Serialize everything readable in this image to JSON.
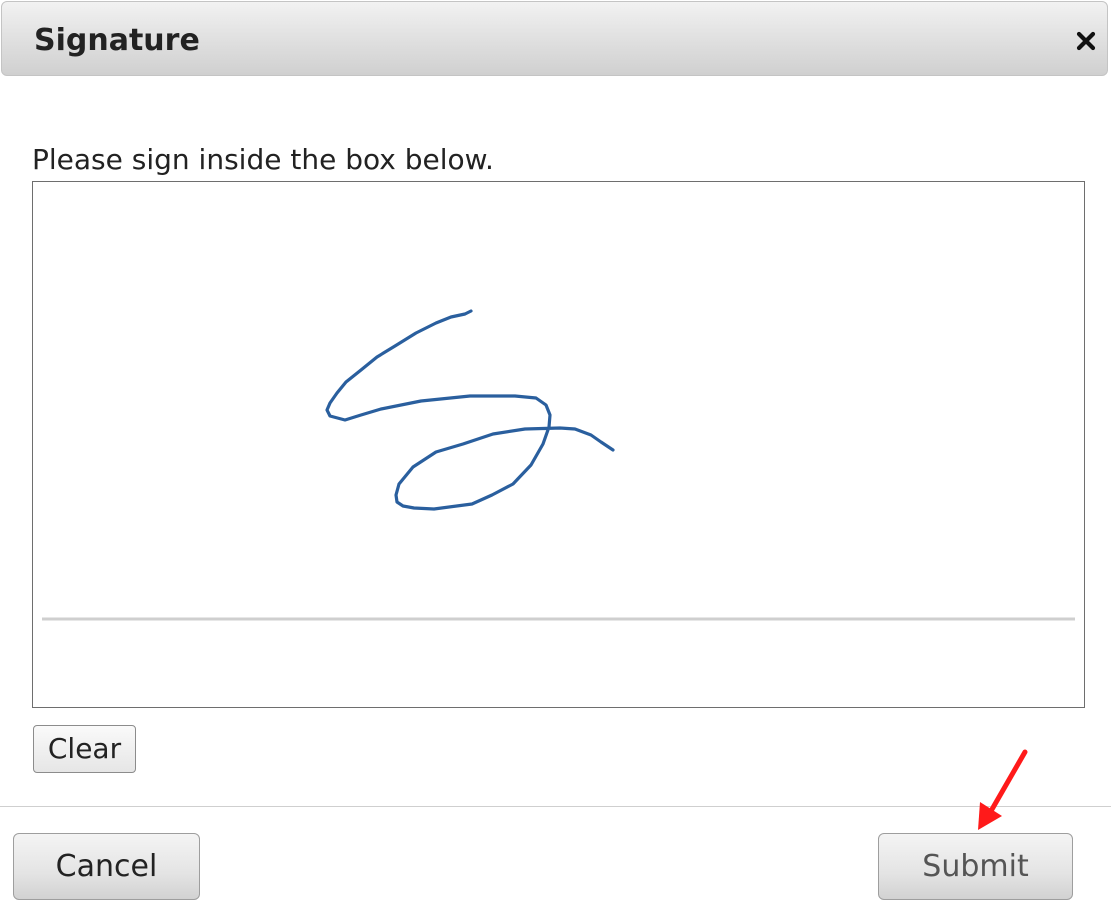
{
  "dialog": {
    "title": "Signature",
    "close_icon": "close-icon",
    "instruction": "Please sign inside the box below.",
    "clear_label": "Clear",
    "cancel_label": "Cancel",
    "submit_label": "Submit"
  },
  "colors": {
    "signature_ink": "#2a5f9e",
    "annotation_arrow": "#ff1a1a",
    "baseline": "#cfcfcf"
  },
  "annotation": {
    "arrow_icon": "red-arrow-annotation-pointing-at-submit"
  }
}
